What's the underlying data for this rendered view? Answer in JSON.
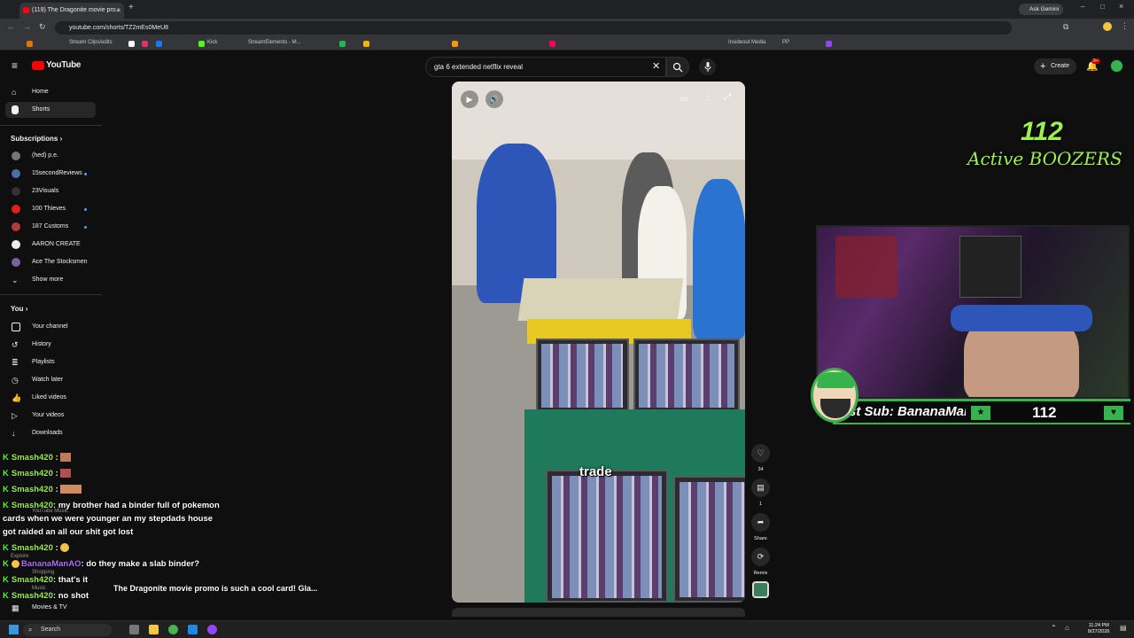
{
  "browser": {
    "tab_title": "(119) The Dragonite movie pro...",
    "url": "youtube.com/shorts/TZ2mEs0MeU8",
    "ask_gemini": "Ask Gemini",
    "bookmarks": [
      "Stream Clips/edits",
      "Kick",
      "StreamElements - M...",
      "Insideout Media",
      "PP"
    ]
  },
  "yt": {
    "logo": "YouTube",
    "search_value": "gta 6 extended netflix reveal",
    "create_label": "Create",
    "notif_count": "9+"
  },
  "sidebar": {
    "main": [
      {
        "label": "Home"
      },
      {
        "label": "Shorts"
      }
    ],
    "subs_heading": "Subscriptions",
    "subs": [
      {
        "label": "(hed) p.e.",
        "color": "#777777"
      },
      {
        "label": "15secondReviews",
        "color": "#4a6fa5"
      },
      {
        "label": "23Visuals",
        "color": "#222222"
      },
      {
        "label": "100 Thieves",
        "color": "#e01f1f"
      },
      {
        "label": "187 Customs",
        "color": "#b33a3a"
      },
      {
        "label": "AARON CREATE",
        "color": "#eeeeee"
      },
      {
        "label": "Ace The Stocksmen",
        "color": "#7b5fa0"
      }
    ],
    "show_more": "Show more",
    "you_heading": "You",
    "you": [
      {
        "label": "Your channel"
      },
      {
        "label": "History"
      },
      {
        "label": "Playlists"
      },
      {
        "label": "Watch later"
      },
      {
        "label": "Liked videos"
      },
      {
        "label": "Your videos"
      },
      {
        "label": "Downloads"
      }
    ],
    "movies_tv": "Movies & TV"
  },
  "short": {
    "caption_word": "trade",
    "like_count": "34",
    "comment_count": "1",
    "share_label": "Share",
    "remix_label": "Remix",
    "title": "The Dragonite movie promo is such a cool card! Gla..."
  },
  "overlay": {
    "boozers_count": "112",
    "boozers_label": "Active BOOZERS",
    "latest_sub": "st Sub: BananaMan",
    "sub_count": "112",
    "accent": "#37b24d"
  },
  "chat": [
    {
      "user": "Smash420",
      "msg": ":"
    },
    {
      "user": "Smash420",
      "msg": ":"
    },
    {
      "user": "Smash420",
      "msg": ":"
    },
    {
      "user": "Smash420",
      "msg": ": my brother had a binder full of pokemon"
    },
    {
      "user": "",
      "msg": "cards when we were younger an my stepdads house"
    },
    {
      "user": "",
      "msg": "got raided an all our shit got lost"
    },
    {
      "user": "Smash420",
      "msg": ":"
    },
    {
      "user": "BananaManAO",
      "msg": ": do they make a slab binder?"
    },
    {
      "user": "Smash420",
      "msg": ": that's it"
    },
    {
      "user": "Smash420",
      "msg": ": no shot"
    }
  ],
  "taskbar": {
    "search": "Search",
    "time": "11:24 PM",
    "date": "8/27/2026"
  }
}
